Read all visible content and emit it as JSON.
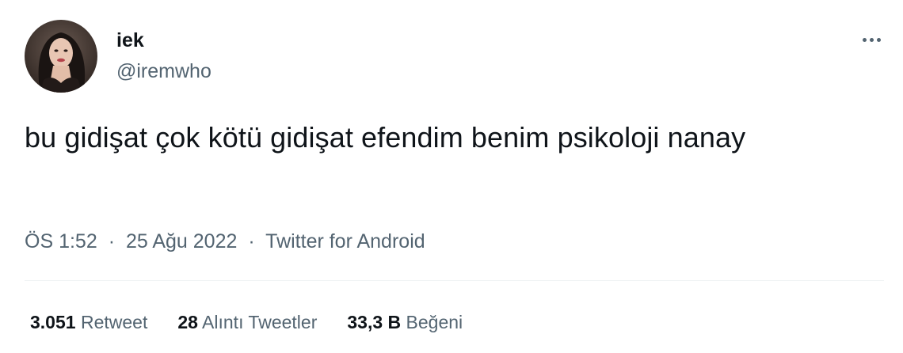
{
  "author": {
    "display_name": "iek",
    "handle": "@iremwho"
  },
  "tweet": {
    "text": "bu gidişat çok kötü gidişat efendim benim psikoloji nanay"
  },
  "meta": {
    "time": "ÖS 1:52",
    "separator": "·",
    "date": "25 Ağu 2022",
    "source": "Twitter for Android"
  },
  "stats": {
    "retweets": {
      "value": "3.051",
      "label": "Retweet"
    },
    "quotes": {
      "value": "28",
      "label": "Alıntı Tweetler"
    },
    "likes": {
      "value": "33,3 B",
      "label": "Beğeni"
    }
  },
  "icons": {
    "more": "more-horizontal-icon",
    "avatar": "profile-photo"
  },
  "colors": {
    "text_primary": "#0f1419",
    "text_secondary": "#536471",
    "divider": "#eff3f4"
  }
}
